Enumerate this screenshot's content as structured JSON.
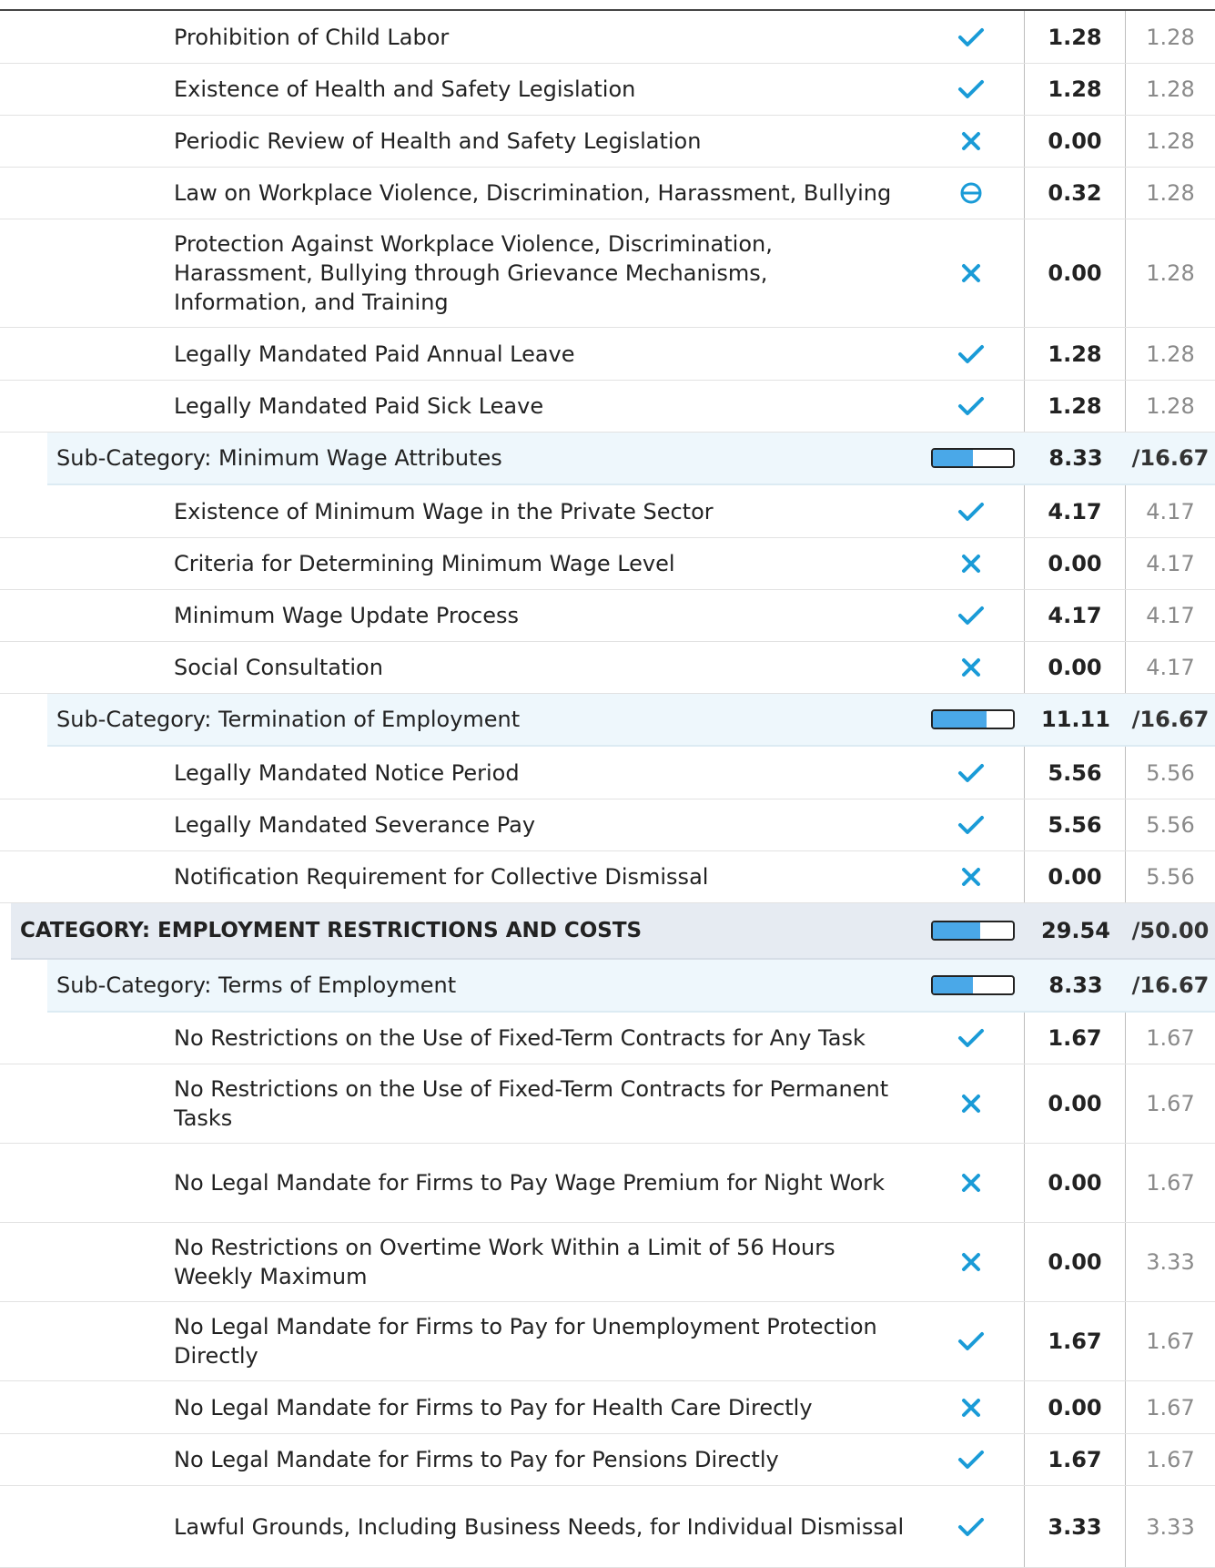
{
  "rows": [
    {
      "type": "item",
      "label": "Prohibition of Child Labor",
      "status": "check",
      "score": "1.28",
      "max": "1.28",
      "h": 58
    },
    {
      "type": "item",
      "label": "Existence of Health and Safety Legislation",
      "status": "check",
      "score": "1.28",
      "max": "1.28",
      "h": 57
    },
    {
      "type": "item",
      "label": "Periodic Review of Health and Safety Legislation",
      "status": "cross",
      "score": "0.00",
      "max": "1.28",
      "h": 57
    },
    {
      "type": "item",
      "label": "Law on Workplace Violence, Discrimination, Harassment, Bullying",
      "status": "partial",
      "score": "0.32",
      "max": "1.28",
      "h": 57
    },
    {
      "type": "item",
      "label": "Protection Against Workplace Violence, Discrimination, Harassment, Bullying through Grievance Mechanisms, Information, and Training",
      "status": "cross",
      "score": "0.00",
      "max": "1.28",
      "h": 119
    },
    {
      "type": "item",
      "label": "Legally Mandated Paid Annual Leave",
      "status": "check",
      "score": "1.28",
      "max": "1.28",
      "h": 58
    },
    {
      "type": "item",
      "label": "Legally Mandated Paid Sick Leave",
      "status": "check",
      "score": "1.28",
      "max": "1.28",
      "h": 57
    },
    {
      "type": "sub",
      "label": "Sub-Category: Minimum Wage Attributes",
      "progress": 0.5,
      "score": "8.33",
      "max": "/16.67",
      "h": 58
    },
    {
      "type": "item",
      "label": "Existence of Minimum Wage in the Private Sector",
      "status": "check",
      "score": "4.17",
      "max": "4.17",
      "h": 58
    },
    {
      "type": "item",
      "label": "Criteria for Determining Minimum Wage Level",
      "status": "cross",
      "score": "0.00",
      "max": "4.17",
      "h": 57
    },
    {
      "type": "item",
      "label": "Minimum Wage Update Process",
      "status": "check",
      "score": "4.17",
      "max": "4.17",
      "h": 57
    },
    {
      "type": "item",
      "label": "Social Consultation",
      "status": "cross",
      "score": "0.00",
      "max": "4.17",
      "h": 57
    },
    {
      "type": "sub",
      "label": "Sub-Category: Termination of Employment",
      "progress": 0.667,
      "score": "11.11",
      "max": "/16.67",
      "h": 58
    },
    {
      "type": "item",
      "label": "Legally Mandated Notice Period",
      "status": "check",
      "score": "5.56",
      "max": "5.56",
      "h": 58
    },
    {
      "type": "item",
      "label": "Legally Mandated Severance Pay",
      "status": "check",
      "score": "5.56",
      "max": "5.56",
      "h": 57
    },
    {
      "type": "item",
      "label": "Notification Requirement for Collective Dismissal",
      "status": "cross",
      "score": "0.00",
      "max": "5.56",
      "h": 57
    },
    {
      "type": "cat",
      "label": "CATEGORY: EMPLOYMENT RESTRICTIONS AND COSTS",
      "progress": 0.59,
      "score": "29.54",
      "max": "/50.00",
      "h": 62
    },
    {
      "type": "sub",
      "label": "Sub-Category: Terms of Employment",
      "progress": 0.5,
      "score": "8.33",
      "max": "/16.67",
      "h": 58
    },
    {
      "type": "item",
      "label": "No Restrictions on the Use of Fixed-Term Contracts for Any Task",
      "status": "check",
      "score": "1.67",
      "max": "1.67",
      "h": 57
    },
    {
      "type": "item",
      "label": "No Restrictions on the Use of Fixed-Term Contracts for Permanent Tasks",
      "status": "cross",
      "score": "0.00",
      "max": "1.67",
      "h": 87
    },
    {
      "type": "item",
      "label": "No Legal Mandate for Firms to Pay Wage Premium for Night Work",
      "status": "cross",
      "score": "0.00",
      "max": "1.67",
      "h": 87
    },
    {
      "type": "item",
      "label": "No Restrictions on Overtime Work Within a Limit of 56 Hours Weekly Maximum",
      "status": "cross",
      "score": "0.00",
      "max": "3.33",
      "h": 87
    },
    {
      "type": "item",
      "label": "No Legal Mandate for Firms to Pay for Unemployment Protection Directly",
      "status": "check",
      "score": "1.67",
      "max": "1.67",
      "h": 87
    },
    {
      "type": "item",
      "label": "No Legal Mandate for Firms to Pay for Health Care Directly",
      "status": "cross",
      "score": "0.00",
      "max": "1.67",
      "h": 58
    },
    {
      "type": "item",
      "label": "No Legal Mandate for Firms to Pay for Pensions Directly",
      "status": "check",
      "score": "1.67",
      "max": "1.67",
      "h": 57
    },
    {
      "type": "item",
      "label": "Lawful Grounds, Including Business Needs, for Individual Dismissal",
      "status": "check",
      "score": "3.33",
      "max": "3.33",
      "h": 90
    }
  ],
  "colors": {
    "accent": "#1a9bd7",
    "bar_fill": "#4aa8e8"
  }
}
